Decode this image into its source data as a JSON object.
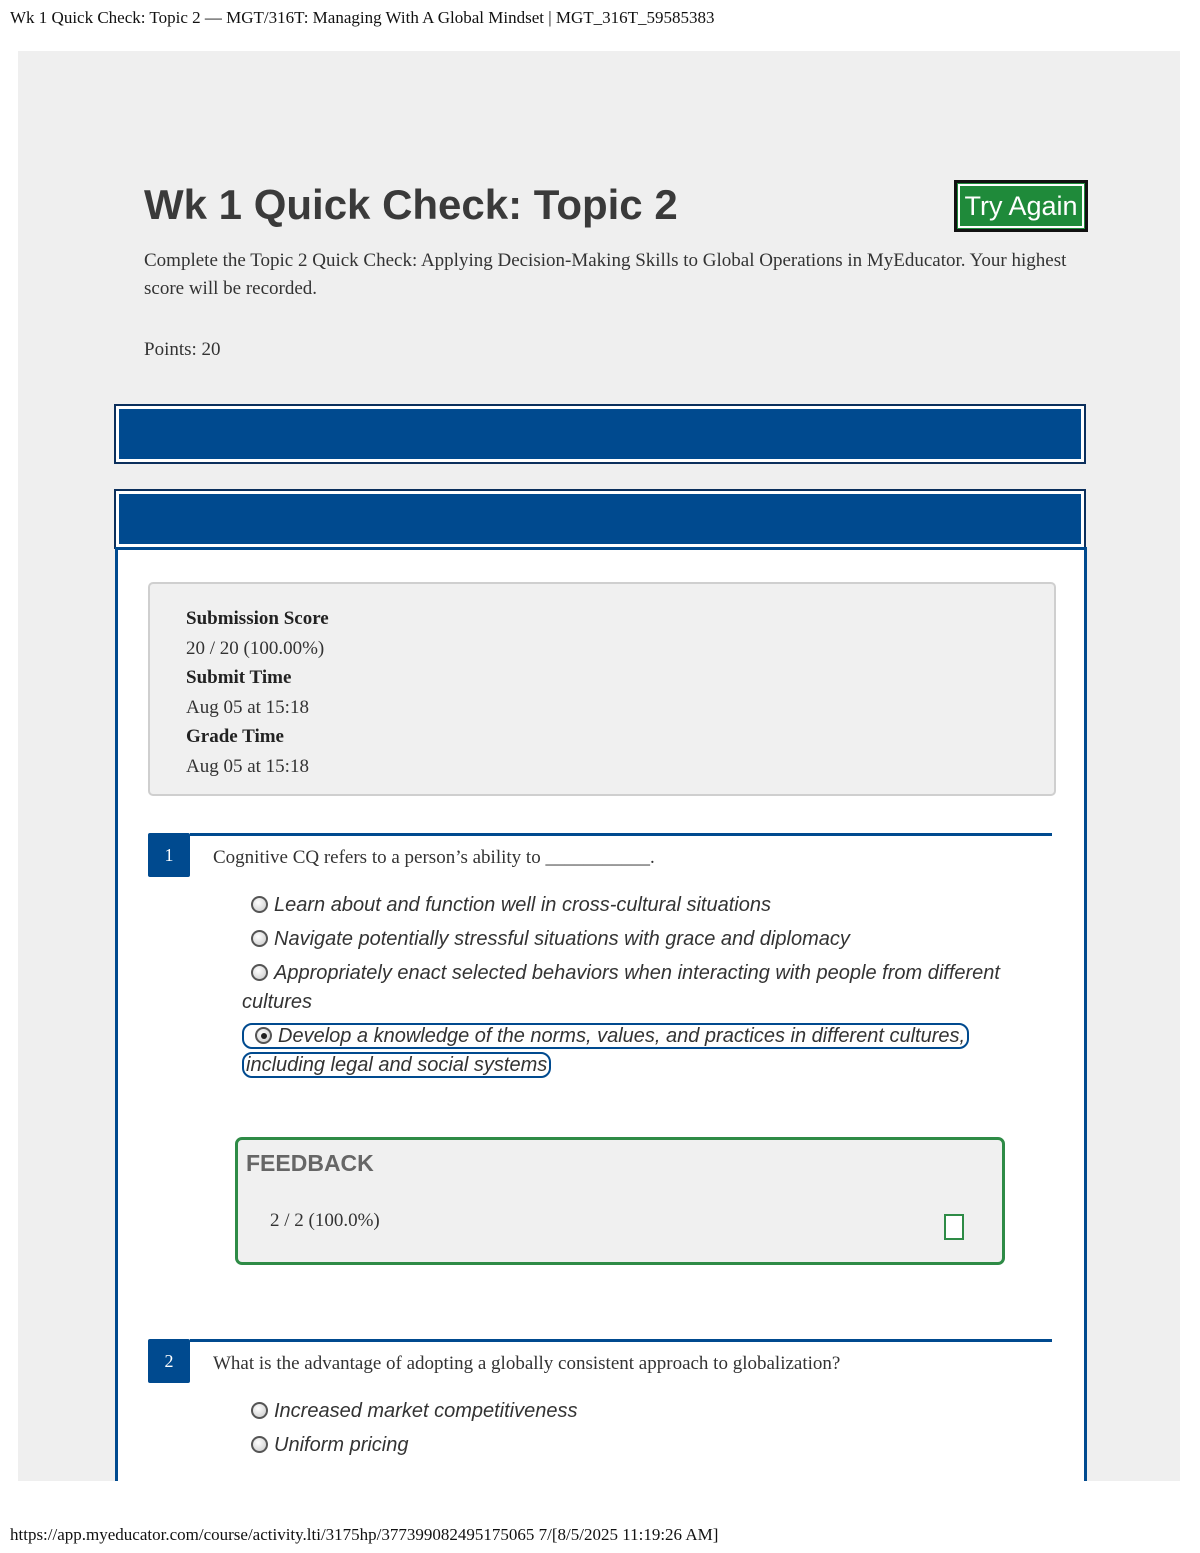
{
  "print": {
    "header": "Wk 1 Quick Check: Topic 2 — MGT/316T: Managing With A Global Mindset | MGT_316T_59585383",
    "footer": "https://app.myeducator.com/course/activity.lti/3175hp/377399082495175065 7/[8/5/2025 11:19:26 AM]"
  },
  "assignment": {
    "title": "Wk 1 Quick Check: Topic 2",
    "try_again_label": "Try Again",
    "description": "Complete the Topic 2 Quick Check: Applying Decision-Making Skills to Global Operations in MyEducator. Your highest score will be recorded.",
    "points": "Points: 20"
  },
  "submission": {
    "score_label": "Submission Score",
    "score_value": "20 / 20 (100.00%)",
    "submit_label": "Submit Time",
    "submit_value": "Aug 05 at 15:18",
    "grade_label": "Grade Time",
    "grade_value": "Aug 05 at 15:18"
  },
  "questions": [
    {
      "number": "1",
      "text": "Cognitive CQ refers to a person’s ability to ___________.",
      "options": [
        "Learn about and function well in cross-cultural situations",
        "Navigate potentially stressful situations with grace and diplomacy",
        "Appropriately enact selected behaviors when interacting with people from different cultures",
        "Develop a knowledge of the norms, values, and practices in different cultures, including legal and social systems"
      ],
      "selected_index": 3,
      "feedback_title": "FEEDBACK",
      "feedback_score": "2 / 2  (100.0%)"
    },
    {
      "number": "2",
      "text": "What is the advantage of adopting a globally consistent approach to globalization?",
      "options": [
        "Increased market competitiveness",
        "Uniform pricing"
      ]
    }
  ],
  "colors": {
    "brand_blue": "#004a8f",
    "success_green": "#2e8b46",
    "button_green": "#1f8a3a",
    "panel_gray": "#efefef"
  }
}
